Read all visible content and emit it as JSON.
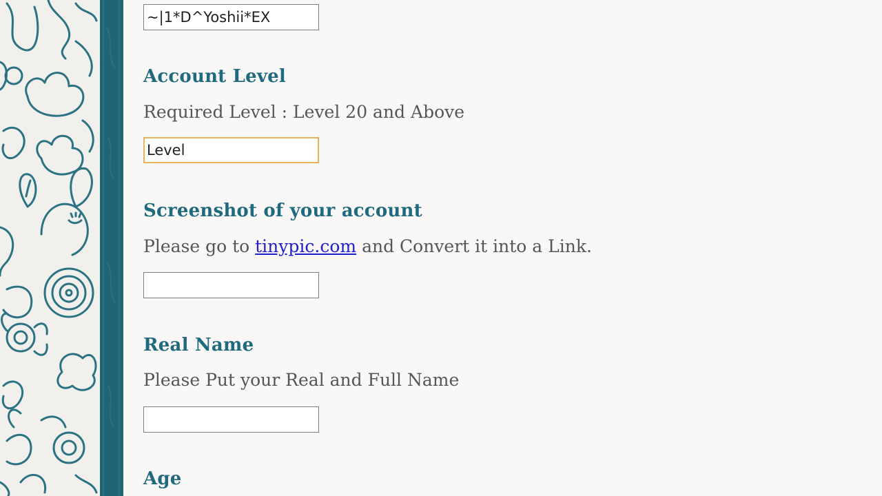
{
  "form": {
    "username_field": {
      "value": "~|1*D^Yoshii*EX",
      "placeholder": ""
    },
    "account_level": {
      "heading": "Account Level",
      "description": "Required Level : Level 20 and Above",
      "value": "Level",
      "placeholder": "",
      "focused": true
    },
    "screenshot": {
      "heading": "Screenshot of your account",
      "description_before": "Please go to ",
      "link_text": "tinypic.com",
      "description_after": " and Convert it into a Link.",
      "value": "",
      "placeholder": ""
    },
    "real_name": {
      "heading": "Real Name",
      "description": "Please Put your Real and Full Name",
      "value": "",
      "placeholder": ""
    },
    "age": {
      "heading": "Age"
    }
  },
  "theme": {
    "heading_color": "#1f6a7e",
    "text_color": "#565656",
    "link_color": "#1f1fd0",
    "strip_color": "#1f6573",
    "focus_border": "#e6b45a",
    "pattern_stroke": "#2b7383"
  }
}
